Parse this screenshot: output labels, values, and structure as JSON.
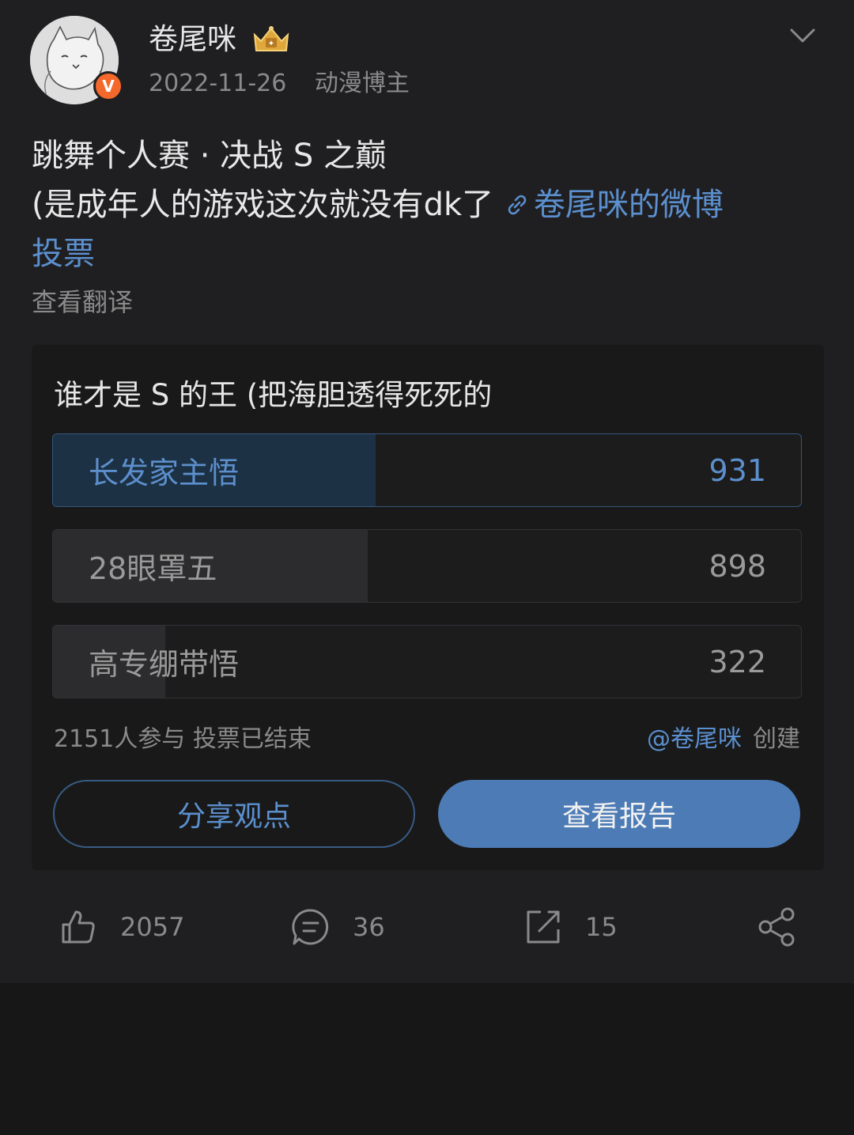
{
  "post": {
    "username": "卷尾咪",
    "verified_badge": "V",
    "date": "2022-11-26",
    "user_tag": "动漫博主",
    "text_line1": "跳舞个人赛 · 决战 S 之巅",
    "text_line2": "(是成年人的游戏这次就没有dk了",
    "link_text": "卷尾咪的微博",
    "link_text2": "投票",
    "translate_label": "查看翻译",
    "icons": [
      "avatar",
      "crown-icon",
      "chevron-down-icon",
      "link-icon"
    ]
  },
  "poll": {
    "title": "谁才是 S 的王 (把海胆透得死死的",
    "options": [
      {
        "label": "长发家主悟",
        "count": "931",
        "fraction": 0.431,
        "selected": true
      },
      {
        "label": "28眼罩五",
        "count": "898",
        "fraction": 0.421,
        "selected": false
      },
      {
        "label": "高专绷带悟",
        "count": "322",
        "fraction": 0.15,
        "selected": false
      }
    ],
    "participants": "2151人参与",
    "status": "投票已结束",
    "creator": "@卷尾咪",
    "created_label": "创建",
    "share_button": "分享观点",
    "report_button": "查看报告",
    "colors": {
      "accent": "#4c7bb6",
      "link": "#5b8fce"
    }
  },
  "actions": {
    "likes": "2057",
    "comments": "36",
    "reposts": "15",
    "icons": [
      "like-icon",
      "comment-icon",
      "repost-icon",
      "share-icon"
    ]
  }
}
